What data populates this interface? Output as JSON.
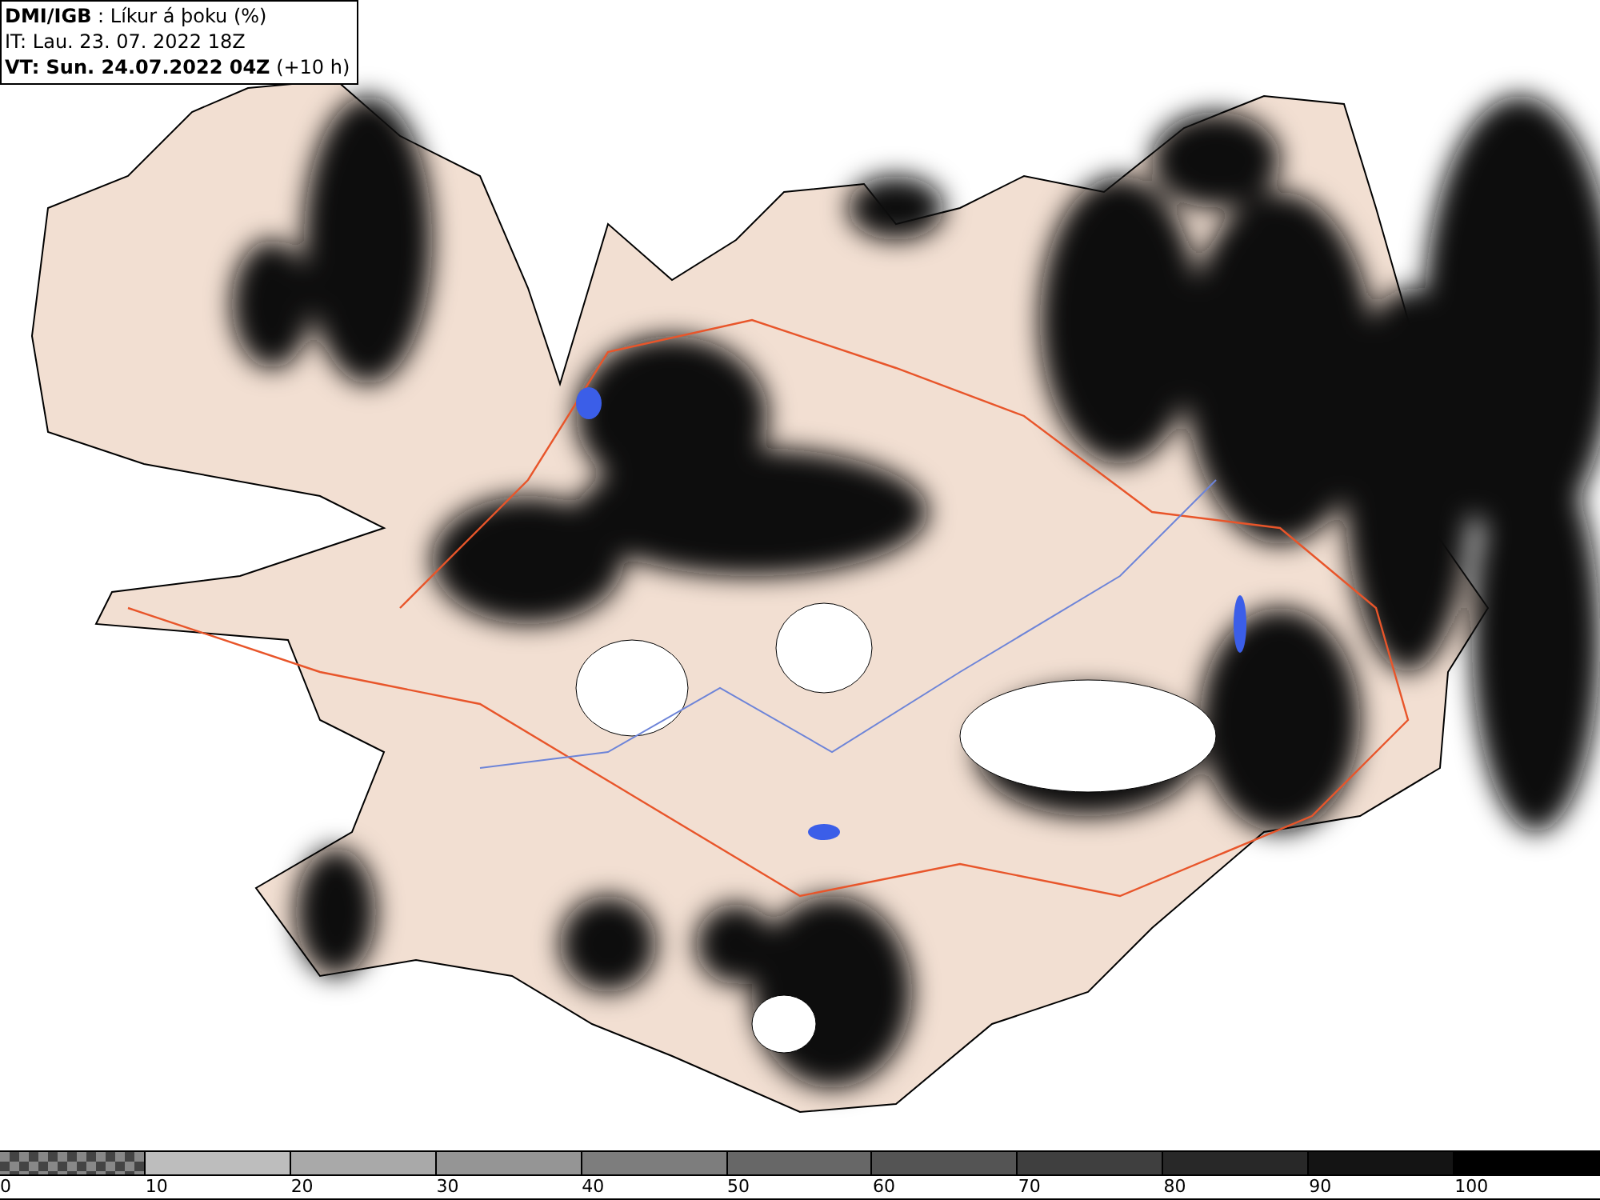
{
  "header": {
    "lines": [
      "**DMI/IGB** : Líkur á þoku (%)",
      "IT: Lau. 23. 07. 2022 18Z",
      "**VT: Sun. 24.07.2022 04Z** (+10 h)"
    ]
  },
  "legend": {
    "segments": [
      {
        "kind": "checker"
      },
      {
        "kind": "solid",
        "color": "#bdbdbd"
      },
      {
        "kind": "solid",
        "color": "#a9a9a9"
      },
      {
        "kind": "solid",
        "color": "#959595"
      },
      {
        "kind": "solid",
        "color": "#7d7d7d"
      },
      {
        "kind": "solid",
        "color": "#676767"
      },
      {
        "kind": "solid",
        "color": "#545454"
      },
      {
        "kind": "solid",
        "color": "#3f3f3f"
      },
      {
        "kind": "solid",
        "color": "#282828"
      },
      {
        "kind": "solid",
        "color": "#141414"
      },
      {
        "kind": "solid",
        "color": "#000000"
      }
    ],
    "ticks": [
      "0",
      "10",
      "20",
      "30",
      "40",
      "50",
      "60",
      "70",
      "80",
      "90",
      "100"
    ]
  }
}
